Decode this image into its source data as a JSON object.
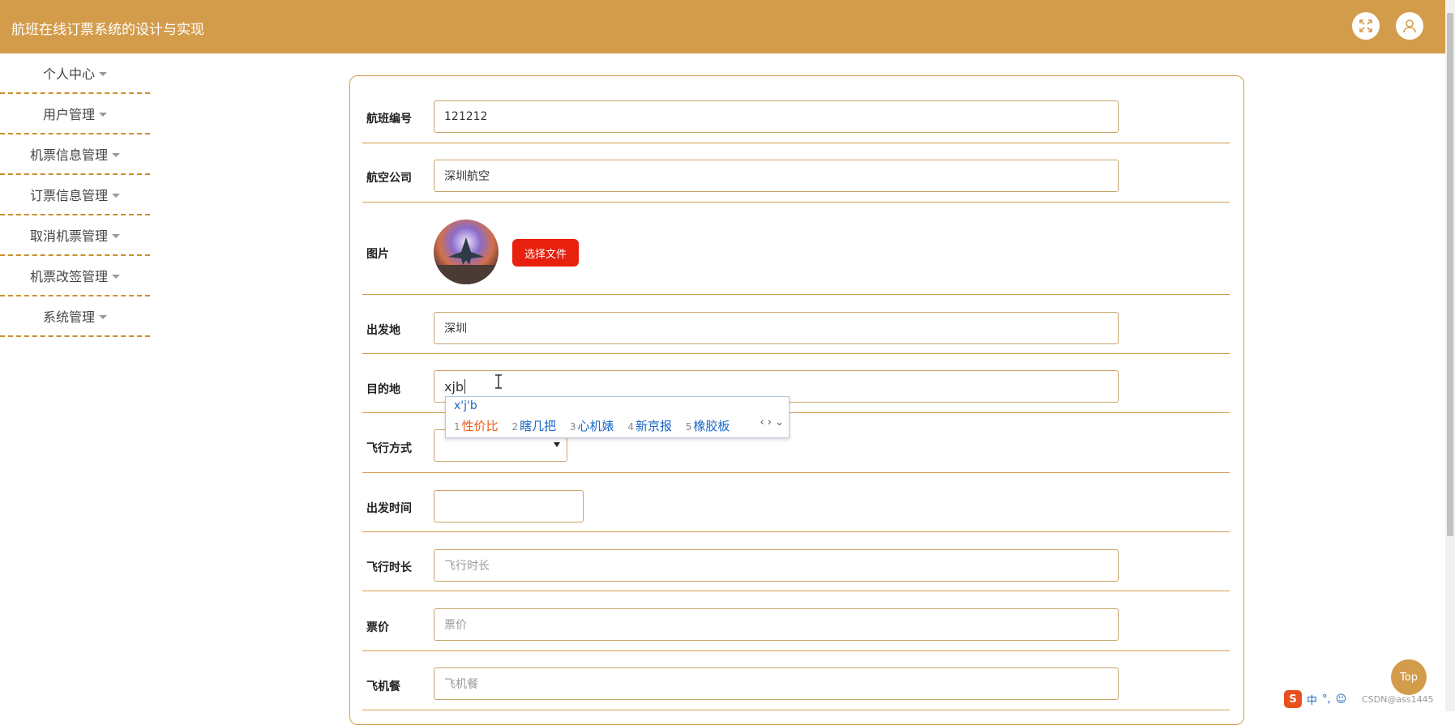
{
  "app": {
    "title": "航班在线订票系统的设计与实现"
  },
  "header": {
    "fullscreen_icon": "expand-arrows-icon",
    "user_icon": "user-icon"
  },
  "sidebar": {
    "items": [
      {
        "label": "个人中心"
      },
      {
        "label": "用户管理"
      },
      {
        "label": "机票信息管理"
      },
      {
        "label": "订票信息管理"
      },
      {
        "label": "取消机票管理"
      },
      {
        "label": "机票改签管理"
      },
      {
        "label": "系统管理"
      }
    ]
  },
  "form": {
    "flight_no": {
      "label": "航班编号",
      "value": "121212"
    },
    "airline": {
      "label": "航空公司",
      "value": "深圳航空"
    },
    "image": {
      "label": "图片",
      "button": "选择文件"
    },
    "departure": {
      "label": "出发地",
      "value": "深圳"
    },
    "destination": {
      "label": "目的地",
      "value": "xjb"
    },
    "flight_mode": {
      "label": "飞行方式",
      "value": ""
    },
    "departure_time": {
      "label": "出发时间",
      "value": ""
    },
    "duration": {
      "label": "飞行时长",
      "placeholder": "飞行时长"
    },
    "price": {
      "label": "票价",
      "placeholder": "票价"
    },
    "meal": {
      "label": "飞机餐",
      "placeholder": "飞机餐"
    }
  },
  "ime": {
    "composition": "x'j'b",
    "candidates": [
      {
        "num": "1",
        "text": "性价比"
      },
      {
        "num": "2",
        "text": "瞎几把"
      },
      {
        "num": "3",
        "text": "心机婊"
      },
      {
        "num": "4",
        "text": "新京报"
      },
      {
        "num": "5",
        "text": "橡胶板"
      }
    ]
  },
  "top_button": {
    "label": "Top"
  },
  "tray": {
    "lang": "中",
    "punct": "°,",
    "watermark": "CSDN@ass1445"
  },
  "colors": {
    "accent": "#d39c4b",
    "danger": "#e8200e",
    "ime_blue": "#1b67c6",
    "ime_selected": "#e85a19"
  }
}
